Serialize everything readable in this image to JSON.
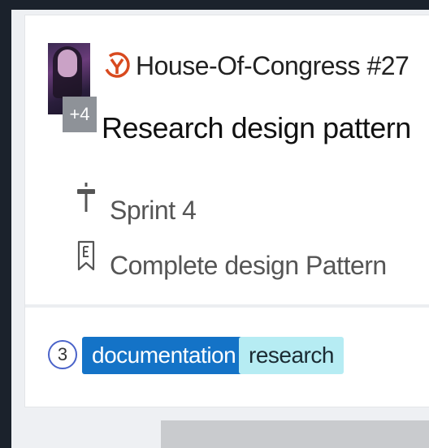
{
  "card": {
    "assignee_extra": "+4",
    "repo": "House-Of-Congress #27",
    "title": "Research design pattern",
    "milestone": "Sprint 4",
    "epic": "Complete design Pattern",
    "estimate": "3",
    "labels": [
      {
        "text": "documentation",
        "color": "#1473c7"
      },
      {
        "text": "research",
        "color": "#b6ecf3"
      }
    ]
  },
  "colors": {
    "repo_icon": "#d84a1f",
    "estimate_ring": "#4a63c9"
  },
  "icons": {
    "repo": "repo-logo-icon",
    "milestone": "milestone-icon",
    "epic": "bookmark-epic-icon"
  }
}
